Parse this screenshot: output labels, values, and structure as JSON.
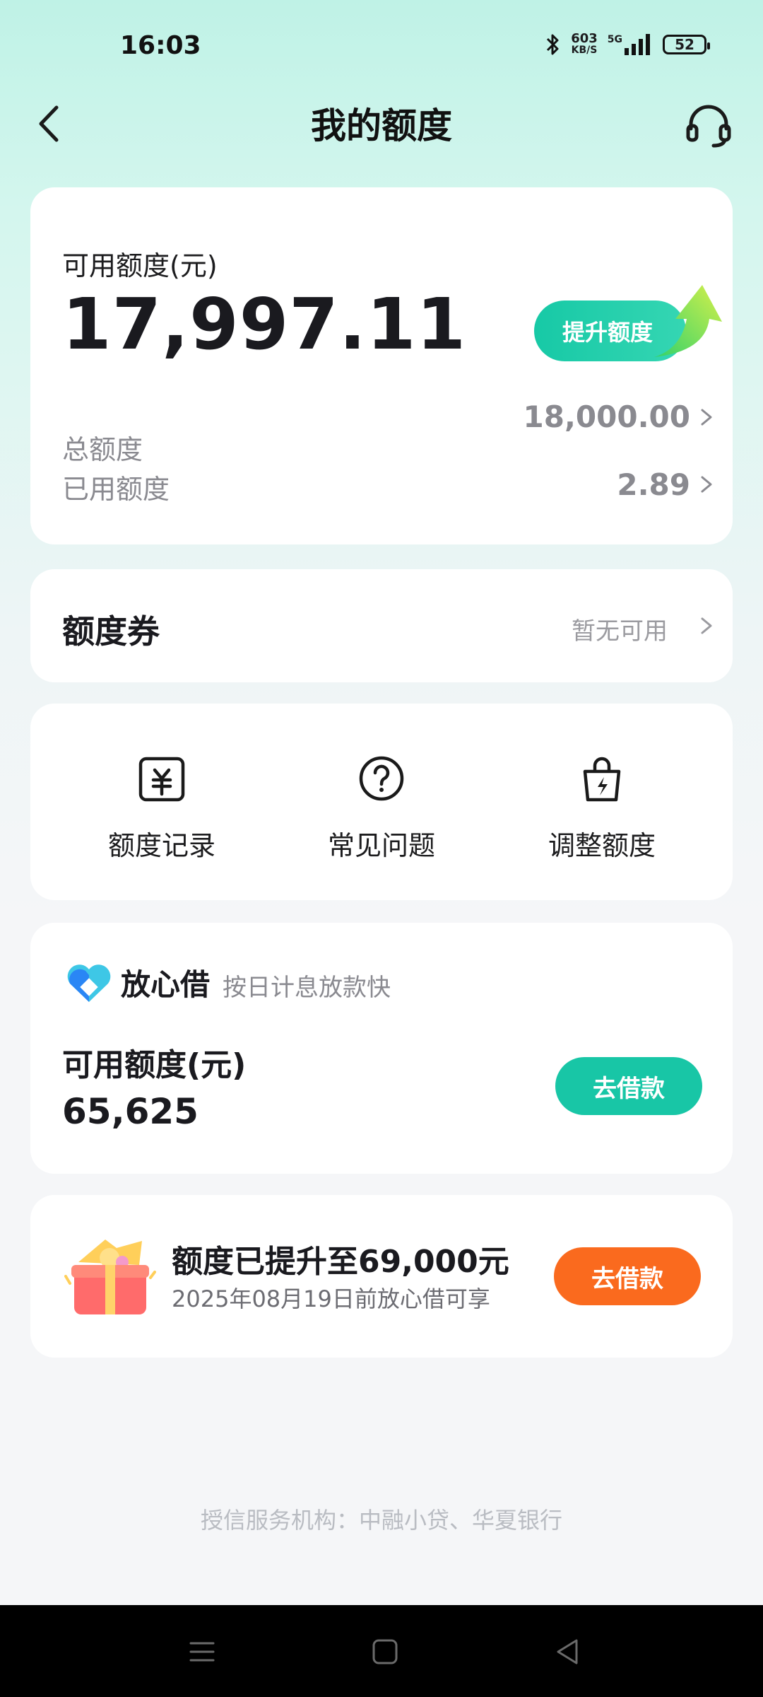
{
  "status_bar": {
    "time": "16:03",
    "net_speed_value": "603",
    "net_speed_unit": "KB/S",
    "signal_label": "5G",
    "battery": "52"
  },
  "header": {
    "title": "我的额度",
    "back_icon": "chevron-left-icon",
    "support_icon": "headset-icon"
  },
  "quota": {
    "available_label": "可用额度(元)",
    "available_value": "17,997.11",
    "raise_button": "提升额度",
    "total_label": "总额度",
    "total_value": "18,000.00",
    "used_label": "已用额度",
    "used_value": "2.89"
  },
  "coupon": {
    "label": "额度券",
    "status": "暂无可用"
  },
  "actions": [
    {
      "label": "额度记录",
      "icon": "yuan-receipt-icon"
    },
    {
      "label": "常见问题",
      "icon": "question-circle-icon"
    },
    {
      "label": "调整额度",
      "icon": "lightning-bag-icon"
    }
  ],
  "fangxinjie": {
    "brand": "放心借",
    "tagline": "按日计息放款快",
    "available_label": "可用额度(元)",
    "available_value": "65,625",
    "button": "去借款"
  },
  "promo": {
    "title": "额度已提升至69,000元",
    "subtitle": "2025年08月19日前放心借可享",
    "button": "去借款"
  },
  "footer": {
    "note": "授信服务机构：中融小贷、华夏银行"
  },
  "colors": {
    "accent_teal": "#18c6a6",
    "accent_orange": "#fa6a1e",
    "header_gradient_top": "#bff2e6"
  }
}
